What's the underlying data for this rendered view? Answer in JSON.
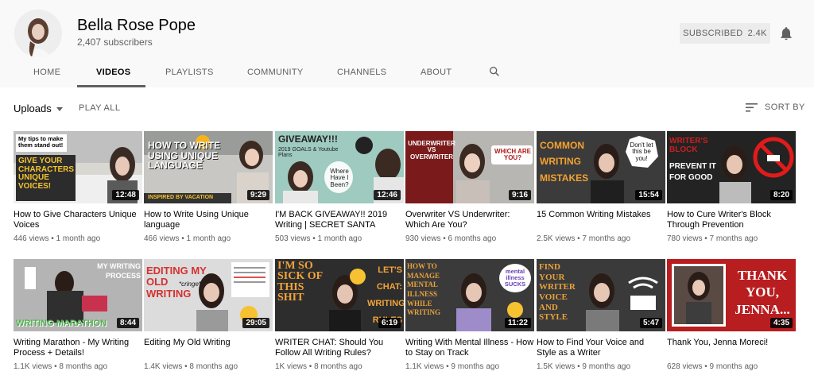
{
  "channel": {
    "name": "Bella Rose Pope",
    "subscribers": "2,407 subscribers",
    "subscribe_button": {
      "label": "SUBSCRIBED",
      "count": "2.4K"
    }
  },
  "tabs": [
    {
      "label": "HOME"
    },
    {
      "label": "VIDEOS",
      "active": true
    },
    {
      "label": "PLAYLISTS"
    },
    {
      "label": "COMMUNITY"
    },
    {
      "label": "CHANNELS"
    },
    {
      "label": "ABOUT"
    }
  ],
  "filters": {
    "uploads": "Uploads",
    "play_all": "PLAY ALL",
    "sort": "SORT BY"
  },
  "icons": [
    "bell-icon",
    "search-icon",
    "sort-icon",
    "dropdown-caret-icon"
  ],
  "videos": [
    {
      "title": "How to Give Characters Unique Voices",
      "views": "446 views",
      "age": "1 month ago",
      "duration": "12:48",
      "thumb_text": [
        "My tips to make them stand out!",
        "GIVE YOUR CHARACTERS UNIQUE VOICES!"
      ]
    },
    {
      "title": "How to Write Using Unique language",
      "views": "466 views",
      "age": "1 month ago",
      "duration": "9:29",
      "thumb_text": [
        "HOW TO WRITE USING UNIQUE LANGUAGE",
        "INSPIRED BY VACATION"
      ]
    },
    {
      "title": "I'M BACK GIVEAWAY!! 2019 Writing | SECRET SANTA",
      "views": "503 views",
      "age": "1 month ago",
      "duration": "12:46",
      "thumb_text": [
        "GIVEAWAY!!!",
        "2019 GOALS & Youtube Plans",
        "Where Have I Been?"
      ]
    },
    {
      "title": "Overwriter VS Underwriter: Which Are You?",
      "views": "930 views",
      "age": "6 months ago",
      "duration": "9:16",
      "thumb_text": [
        "UNDERWRITER VS OVERWRITER",
        "WHICH ARE YOU?"
      ]
    },
    {
      "title": "15 Common Writing Mistakes",
      "views": "2.5K views",
      "age": "7 months ago",
      "duration": "15:54",
      "thumb_text": [
        "COMMON WRITING MISTAKES",
        "Don't let this be you!"
      ]
    },
    {
      "title": "How to Cure Writer's Block Through Prevention",
      "views": "780 views",
      "age": "7 months ago",
      "duration": "8:20",
      "thumb_text": [
        "WRITER'S BLOCK",
        "PREVENT IT FOR GOOD"
      ]
    },
    {
      "title": "Writing Marathon - My Writing Process + Details!",
      "views": "1.1K views",
      "age": "8 months ago",
      "duration": "8:44",
      "thumb_text": [
        "MY WRITING PROCESS",
        "WRITING MARATHON"
      ]
    },
    {
      "title": "Editing My Old Writing",
      "views": "1.4K views",
      "age": "8 months ago",
      "duration": "29:05",
      "thumb_text": [
        "EDITING MY OLD WRITING",
        "*cringe*"
      ]
    },
    {
      "title": "WRITER CHAT: Should You Follow All Writing Rules?",
      "views": "1K views",
      "age": "8 months ago",
      "duration": "6:19",
      "thumb_text": [
        "I'M SO SICK OF THIS SHIT",
        "LET'S CHAT: WRITING RULES"
      ]
    },
    {
      "title": "Writing With Mental Illness - How to Stay on Track",
      "views": "1.1K views",
      "age": "9 months ago",
      "duration": "11:22",
      "thumb_text": [
        "HOW TO MANAGE MENTAL ILLNESS WHILE WRITING",
        "mental illness SUCKS"
      ]
    },
    {
      "title": "How to Find Your Voice and Style as a Writer",
      "views": "1.5K views",
      "age": "9 months ago",
      "duration": "5:47",
      "thumb_text": [
        "FIND YOUR WRITER VOICE AND STYLE"
      ]
    },
    {
      "title": "Thank You, Jenna Moreci!",
      "views": "628 views",
      "age": "9 months ago",
      "duration": "4:35",
      "thumb_text": [
        "THANK YOU, JENNA..."
      ]
    }
  ],
  "colors": {
    "header_bg": "#f9f9f9",
    "text_secondary": "#606060",
    "button_bg": "#ececec"
  }
}
